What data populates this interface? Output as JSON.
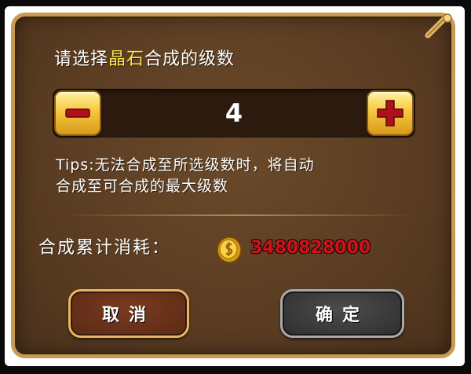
{
  "dialog": {
    "title_prefix": "请选择",
    "title_highlight": "晶石",
    "title_suffix": "合成的级数",
    "level_value": "4",
    "tips_line1": "Tips:无法合成至所选级数时，将自动",
    "tips_line2": "合成至可合成的最大级数",
    "cost_label": "合成累计消耗：",
    "cost_value": "3480828000",
    "cancel_label": "取消",
    "confirm_label": "确定"
  },
  "icons": {
    "minus": "minus-icon",
    "plus": "plus-icon",
    "coin": "gold-coin-icon",
    "corner": "scroll-corner-icon"
  },
  "colors": {
    "highlight": "#ffe24a",
    "cost": "#d0121b",
    "panel": "#5a3c22",
    "gold_button": "#f7c73e"
  }
}
